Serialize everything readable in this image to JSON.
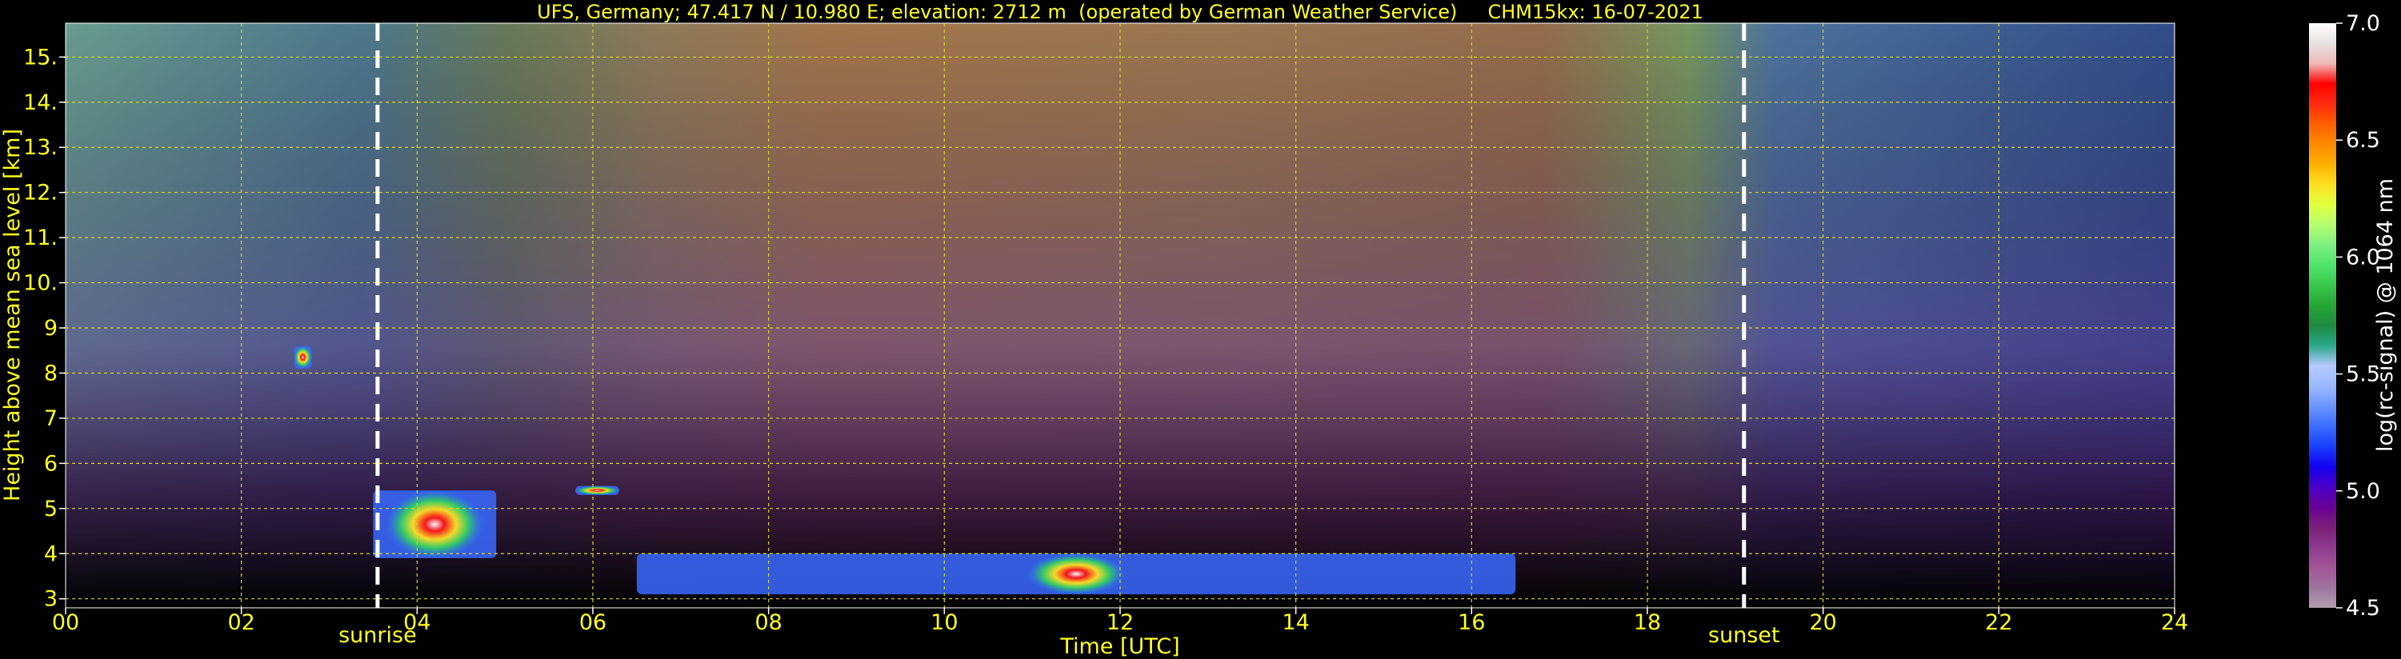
{
  "chart_data": {
    "type": "heatmap",
    "title": "UFS, Germany; 47.417 N / 10.980 E; elevation: 2712 m  (operated by German Weather Service)     CHM15kx: 16-07-2021",
    "xlabel": "Time [UTC]",
    "ylabel": "Height above mean sea level [km]",
    "xlim": [
      0,
      24
    ],
    "ylim": [
      2.8,
      15.75
    ],
    "x_ticks": [
      "00",
      "02",
      "04",
      "06",
      "08",
      "10",
      "12",
      "14",
      "16",
      "18",
      "20",
      "22",
      "24"
    ],
    "y_ticks": [
      "3",
      "4",
      "5",
      "6",
      "7",
      "8",
      "9",
      "10.",
      "11.",
      "12.",
      "13.",
      "14.",
      "15."
    ],
    "grid": true,
    "colorbar": {
      "label": "log(rc-signal) @ 1064 nm",
      "range": [
        4.5,
        7.0
      ],
      "ticks": [
        "4.5",
        "5.0",
        "5.5",
        "6.0",
        "6.5",
        "7.0"
      ],
      "colors": [
        "#b19fb0",
        "#9f739f",
        "#a25597",
        "#8f3a8f",
        "#7a1f78",
        "#6a0098",
        "#4a00c8",
        "#1300f0",
        "#1a40ff",
        "#3c6cff",
        "#6a96ff",
        "#9bb8ff",
        "#b5c9ff",
        "#2aa88a",
        "#1d8a3f",
        "#26a636",
        "#39c84d",
        "#4fe36a",
        "#7df080",
        "#b5ff70",
        "#e2ff40",
        "#ffe020",
        "#ffb000",
        "#ff8a00",
        "#ff6000",
        "#ff2a10",
        "#ff0000",
        "#f0b8b8",
        "#e6e0e0",
        "#ffffff"
      ]
    },
    "events": [
      {
        "label": "sunrise",
        "x": 3.55
      },
      {
        "label": "sunset",
        "x": 19.1
      }
    ],
    "cloud_layers": [
      {
        "x_start": 3.5,
        "x_end": 4.9,
        "base_km": 3.9,
        "top_km": 5.4,
        "max_signal": 7.0
      },
      {
        "x_start": 2.6,
        "x_end": 2.8,
        "base_km": 8.1,
        "top_km": 8.6,
        "max_signal": 6.3
      },
      {
        "x_start": 5.8,
        "x_end": 6.3,
        "base_km": 5.3,
        "top_km": 5.5,
        "max_signal": 6.9
      },
      {
        "x_start": 6.5,
        "x_end": 16.5,
        "base_km": 3.1,
        "top_km": 4.0,
        "max_signal": 7.0
      }
    ]
  },
  "colors": {
    "axis_text": "#ffff22",
    "grid": "#d8d820",
    "event_line": "#ffffff",
    "background": "#000000"
  }
}
